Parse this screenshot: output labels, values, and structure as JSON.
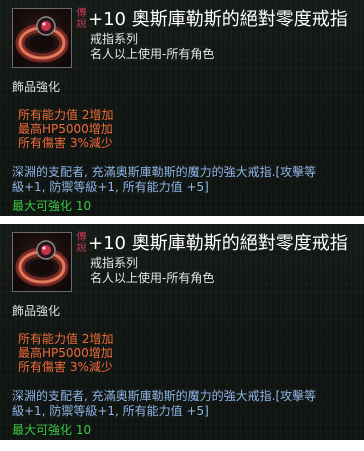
{
  "tooltips": [
    {
      "grade_tag": "傳說",
      "title": "+10 奧斯庫勒斯的絕對零度戒指",
      "category": "戒指系列",
      "requirement": "名人以上使用-所有角色",
      "enhance_label": "飾品強化",
      "stats": [
        "所有能力值 2增加",
        "最高HP5000增加",
        "所有傷害 3%減少"
      ],
      "description_lines": [
        "深淵的支配者, 充滿奧斯庫勒斯的魔力的強大戒指.[攻擊等",
        "級+1, 防禦等級+1, 所有能力值 +5]"
      ],
      "max_enhance": "最大可強化 10",
      "icon": "red-ring-icon"
    },
    {
      "grade_tag": "傳說",
      "title": "+10 奧斯庫勒斯的絕對零度戒指",
      "category": "戒指系列",
      "requirement": "名人以上使用-所有角色",
      "enhance_label": "飾品強化",
      "stats": [
        "所有能力值 2增加",
        "最高HP5000增加",
        "所有傷害 3%減少"
      ],
      "description_lines": [
        "深淵的支配者, 充滿奧斯庫勒斯的魔力的強大戒指.[攻擊等",
        "級+1, 防禦等級+1, 所有能力值 +5]"
      ],
      "max_enhance": "最大可強化 10",
      "icon": "red-ring-icon"
    }
  ],
  "colors": {
    "title": "#ffffff",
    "grade_tag": "#c63a5a",
    "stats": "#f06a3a",
    "description": "#8fb4e6",
    "max_enhance": "#3cc845",
    "background": "#111713"
  }
}
